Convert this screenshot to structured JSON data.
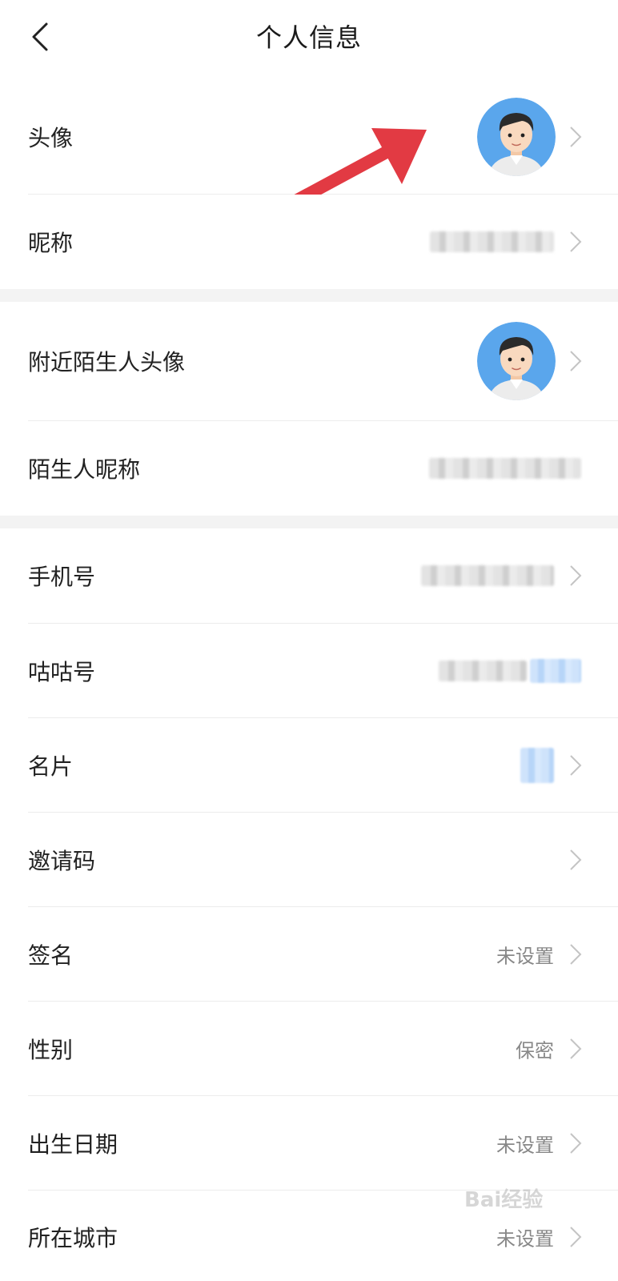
{
  "header": {
    "title": "个人信息"
  },
  "rows": {
    "avatar": {
      "label": "头像"
    },
    "nickname": {
      "label": "昵称"
    },
    "nearby_avatar": {
      "label": "附近陌生人头像"
    },
    "stranger_nickname": {
      "label": "陌生人昵称"
    },
    "phone": {
      "label": "手机号"
    },
    "gugu_id": {
      "label": "咕咕号"
    },
    "card": {
      "label": "名片"
    },
    "invite": {
      "label": "邀请码"
    },
    "signature": {
      "label": "签名",
      "value": "未设置"
    },
    "gender": {
      "label": "性别",
      "value": "保密"
    },
    "birthday": {
      "label": "出生日期",
      "value": "未设置"
    },
    "city": {
      "label": "所在城市",
      "value": "未设置"
    }
  },
  "watermark": {
    "text": "Bai经验"
  },
  "colors": {
    "arrow": "#e23a43",
    "avatar_bg": "#5aa6ec",
    "chevron": "#c4c4c4",
    "gap": "#f3f3f3"
  },
  "icons": {
    "back": "chevron-left-icon",
    "row": "chevron-right-icon",
    "annotation": "red-arrow"
  }
}
